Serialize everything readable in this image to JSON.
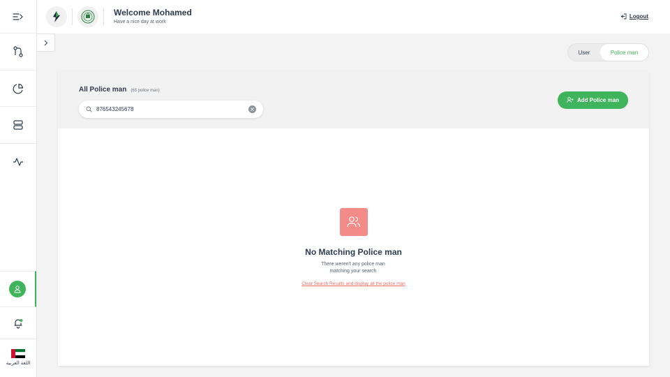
{
  "header": {
    "welcome_title": "Welcome Mohamed",
    "welcome_subtitle": "Have a nice day at work",
    "logout_label": "Logout"
  },
  "sidebar": {
    "icons": [
      "menu-collapse-icon",
      "git-branch-icon",
      "pie-chart-icon",
      "server-icon",
      "activity-icon",
      "user-profile-icon",
      "notification-bell-icon"
    ],
    "language_label": "اللغة العربية"
  },
  "segment": {
    "options": [
      "User",
      "Police man"
    ],
    "selected": "Police man"
  },
  "list": {
    "title": "All Police man",
    "count_label": "(65 police man)",
    "search_value": "876543245678",
    "add_button_label": "Add Police man"
  },
  "empty_state": {
    "title": "No Matching Police man",
    "message": "There weren't any police man matching your search",
    "clear_link": "Clear Search Results and display all the police man"
  },
  "colors": {
    "accent_green": "#3fb45c",
    "empty_icon_bg": "#f38b88",
    "link_red": "#e56b67"
  }
}
